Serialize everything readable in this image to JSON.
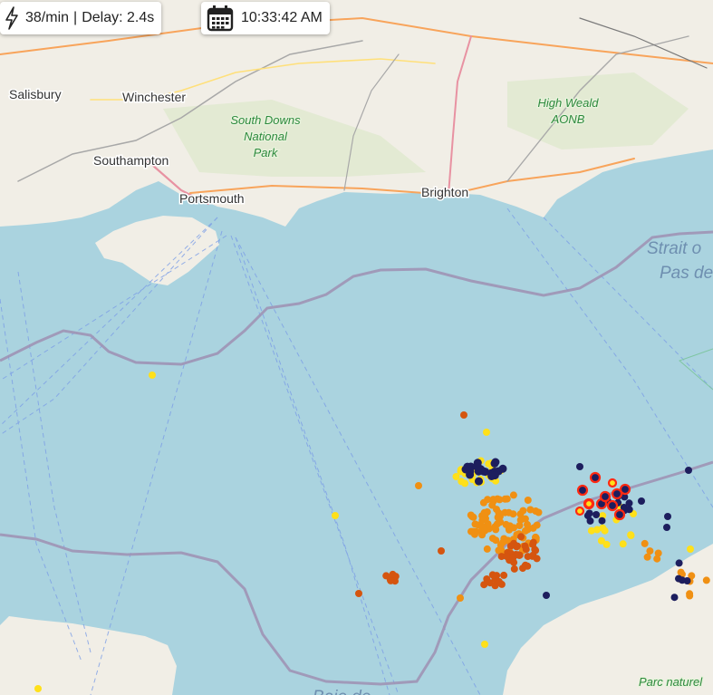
{
  "stats": {
    "rate": "38/min",
    "separator": "|",
    "delay": "Delay: 2.4s",
    "icon": "lightning-icon"
  },
  "clock": {
    "time": "10:33:42 AM",
    "icon": "calendar-icon"
  },
  "map": {
    "places": [
      "Salisbury",
      "Winchester",
      "Southampton",
      "Portsmouth",
      "Brighton"
    ],
    "parks": {
      "south_downs": [
        "South Downs",
        "National",
        "Park"
      ],
      "high_weald": [
        "High Weald",
        "AONB"
      ],
      "parc": "Parc naturel"
    },
    "sea": {
      "strait_line1": "Strait o",
      "strait_line2": "Pas de",
      "baie": "Baie de"
    },
    "colors": {
      "sea": "#aad3df",
      "land": "#f1eee6",
      "border": "#9e93b5",
      "strike_recent": "#ff2a12",
      "strike_yellow": "#ffe01a",
      "strike_orange": "#f09013",
      "strike_darkorange": "#d5550f",
      "strike_navy": "#1d1e5e"
    }
  }
}
